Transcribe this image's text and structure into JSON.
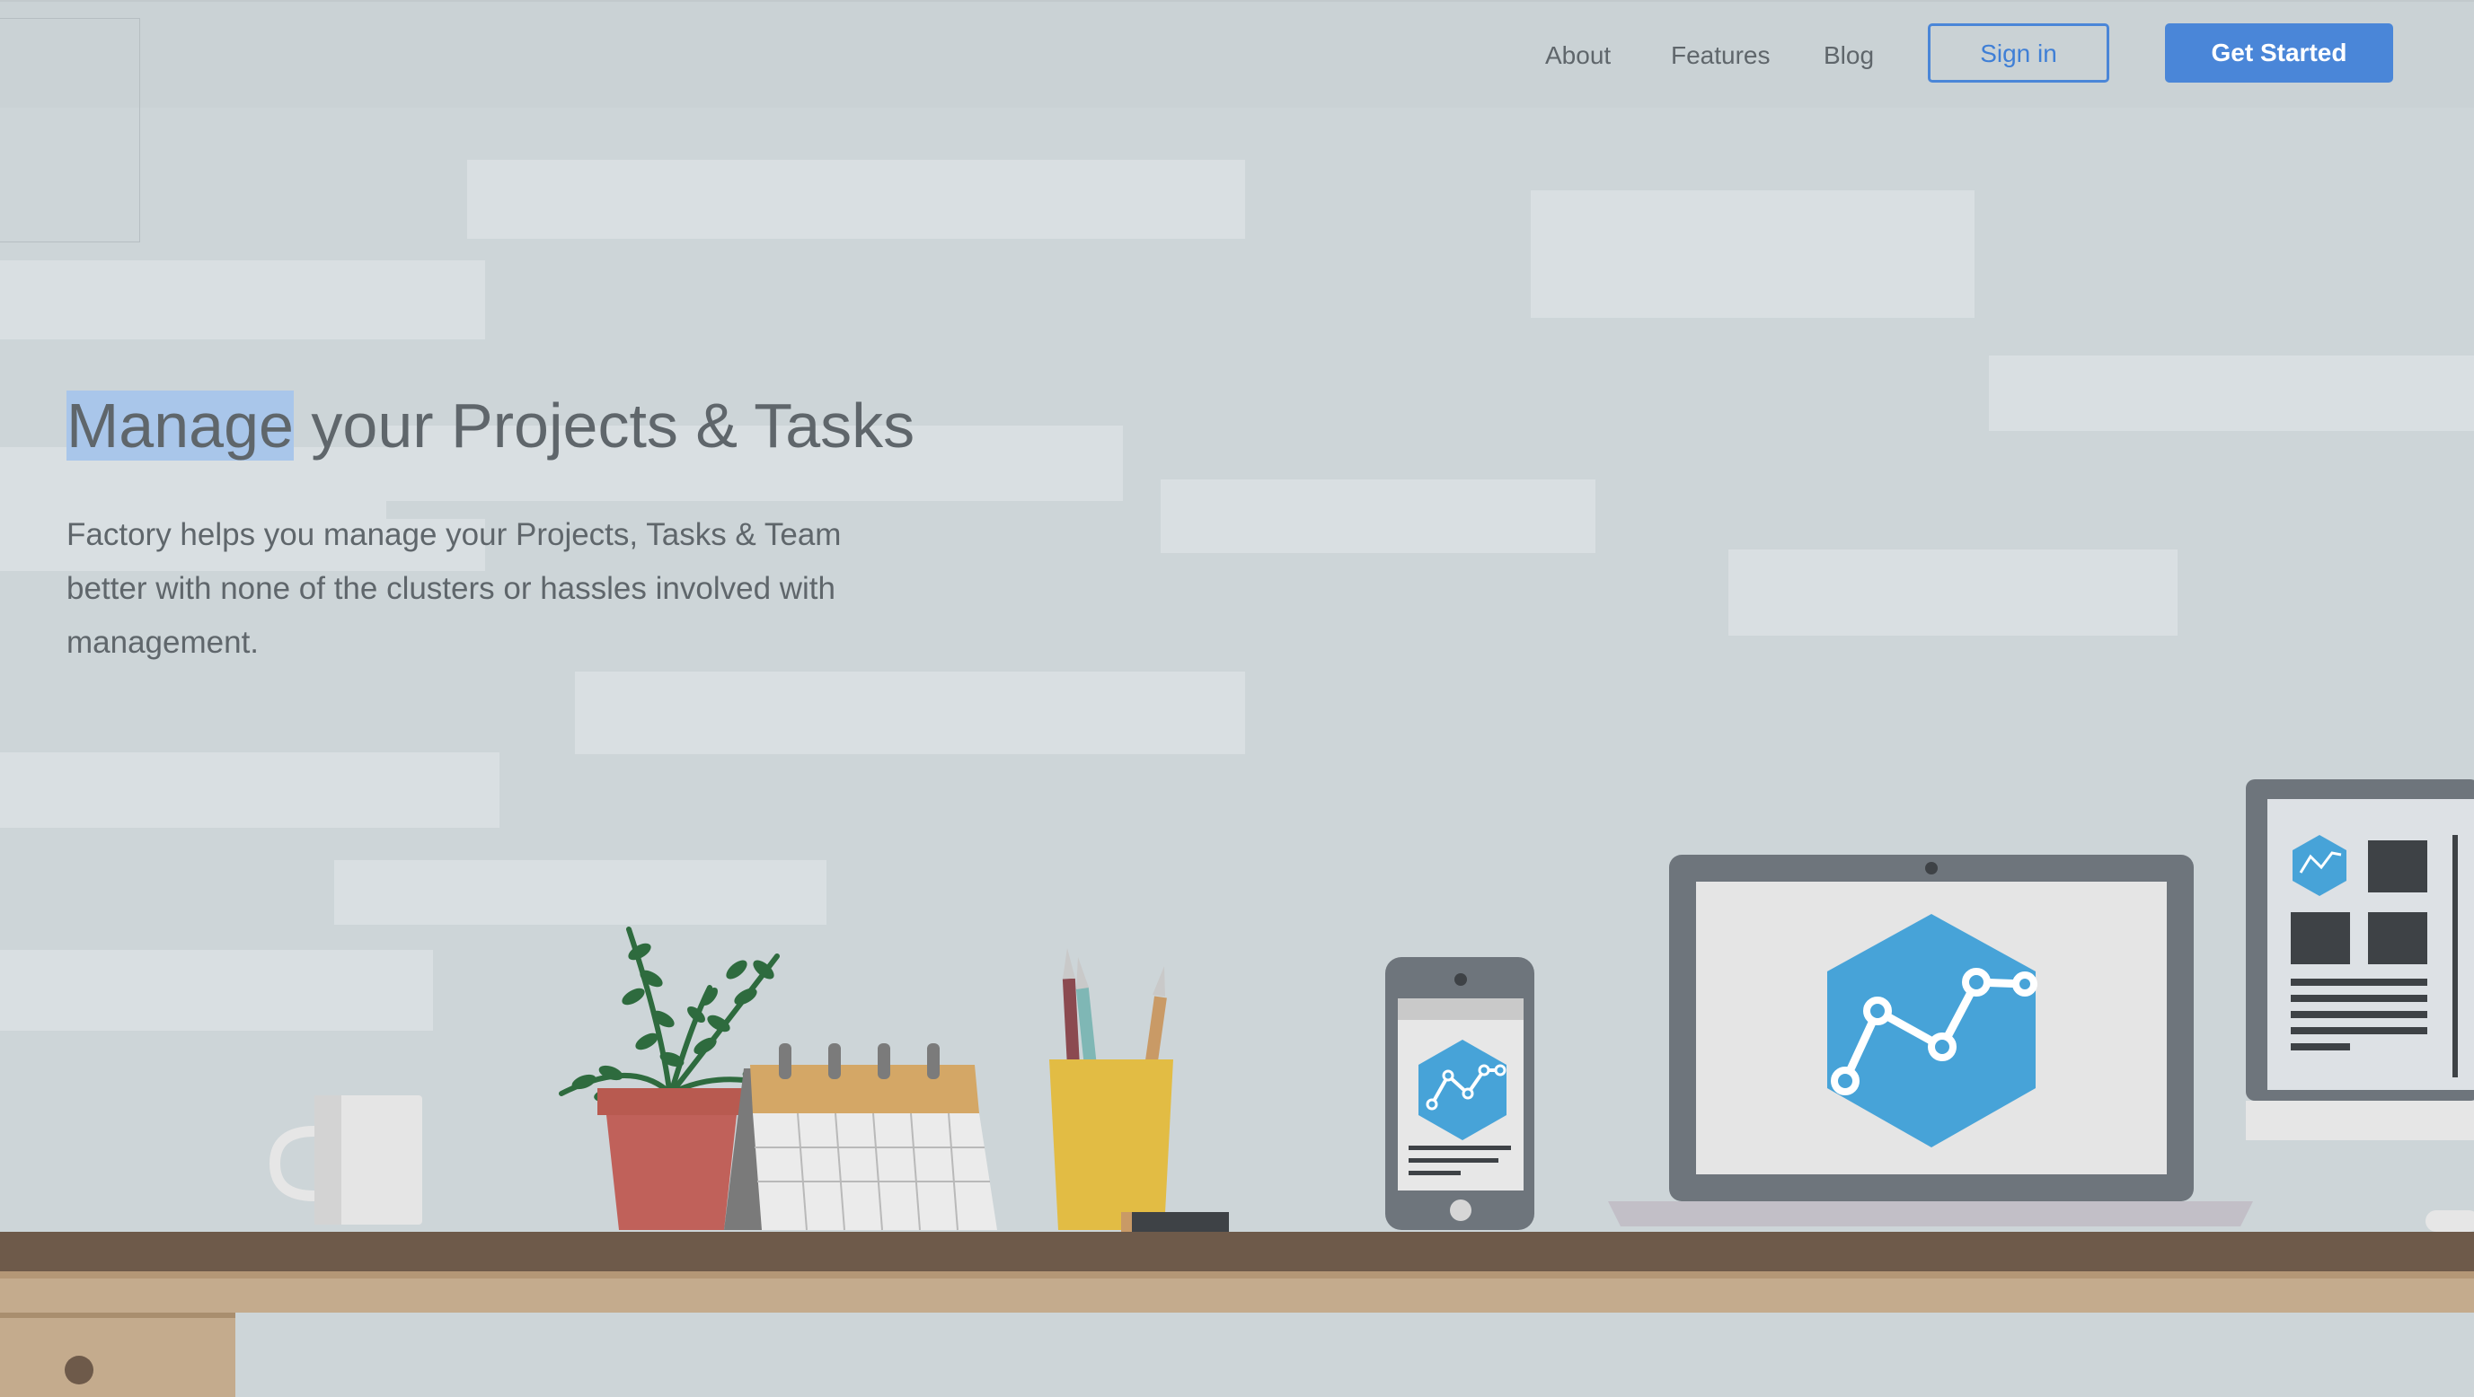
{
  "nav": {
    "links": [
      "About",
      "Features",
      "Blog"
    ],
    "signin_label": "Sign in",
    "cta_label": "Get Started"
  },
  "hero": {
    "title_highlight": "Manage",
    "title_rest": " your Projects & Tasks",
    "description": "Factory helps you manage your Projects, Tasks & Team better with none of the clusters or hassles involved with management."
  },
  "colors": {
    "accent": "#4a86d8",
    "text": "#5f666b",
    "background": "#cdd5d8",
    "desk": "#6e5a4a",
    "brand_hexagon": "#47a3d8"
  },
  "icons": [
    "analytics-hexagon-icon"
  ]
}
